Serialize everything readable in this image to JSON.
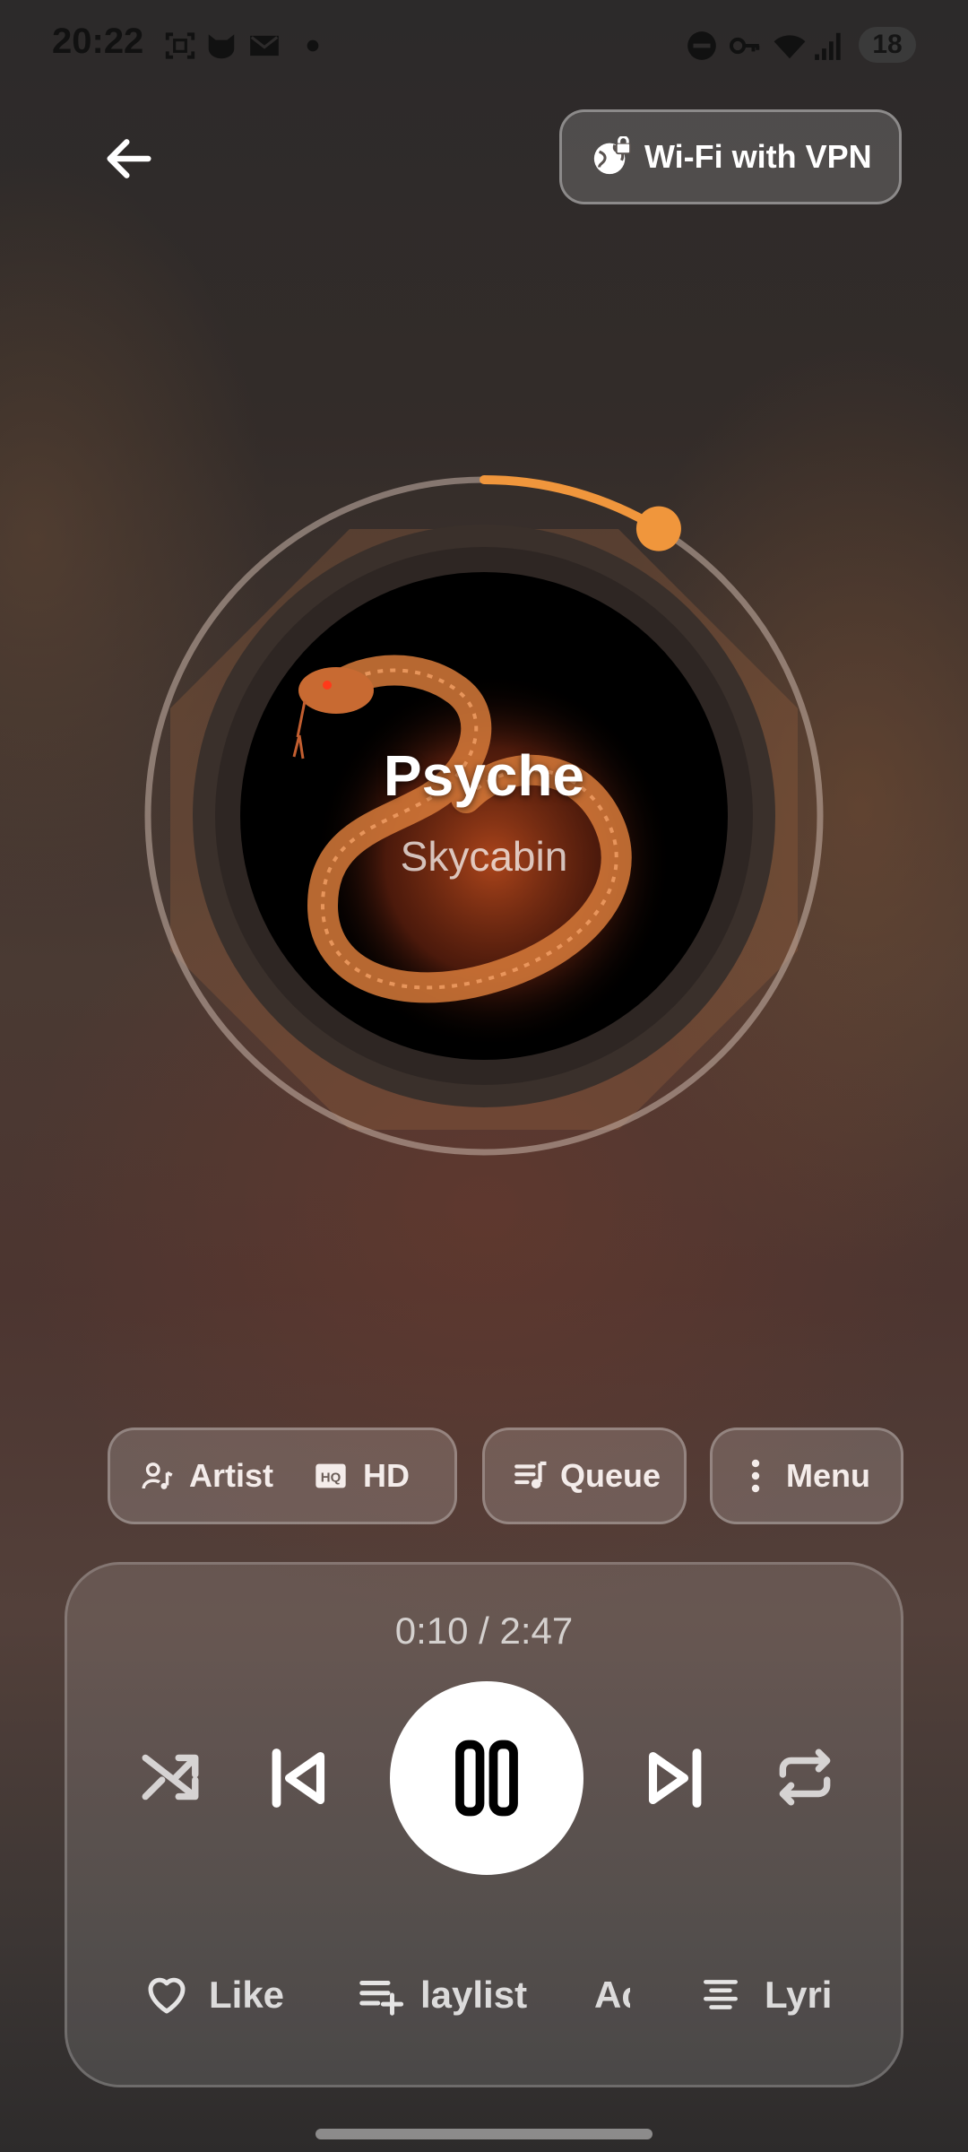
{
  "status_bar": {
    "time": "20:22",
    "battery": "18",
    "left_icons": [
      "screenshot-icon",
      "cat-icon",
      "gmail-icon",
      "dot-icon"
    ],
    "right_icons": [
      "dnd-icon",
      "vpn-key-icon",
      "wifi-icon",
      "signal-icon",
      "battery-icon"
    ]
  },
  "header": {
    "back_icon": "arrow-left-icon",
    "network_badge": "Wi-Fi with VPN",
    "network_icon": "globe-lock-icon"
  },
  "track": {
    "title": "Psyche",
    "artist": "Skycabin",
    "progress_fraction": 0.06,
    "accent_color": "#f0963c"
  },
  "actions": {
    "artist": "Artist",
    "hd": "HD",
    "queue": "Queue",
    "menu": "Menu"
  },
  "player": {
    "time_display": "0:10 / 2:47",
    "controls": [
      "shuffle-icon",
      "previous-icon",
      "pause-icon",
      "next-icon",
      "repeat-icon"
    ]
  },
  "bottom_actions": {
    "like": "Like",
    "playlist": "laylist",
    "add": "Ac",
    "lyrics": "Lyri"
  }
}
